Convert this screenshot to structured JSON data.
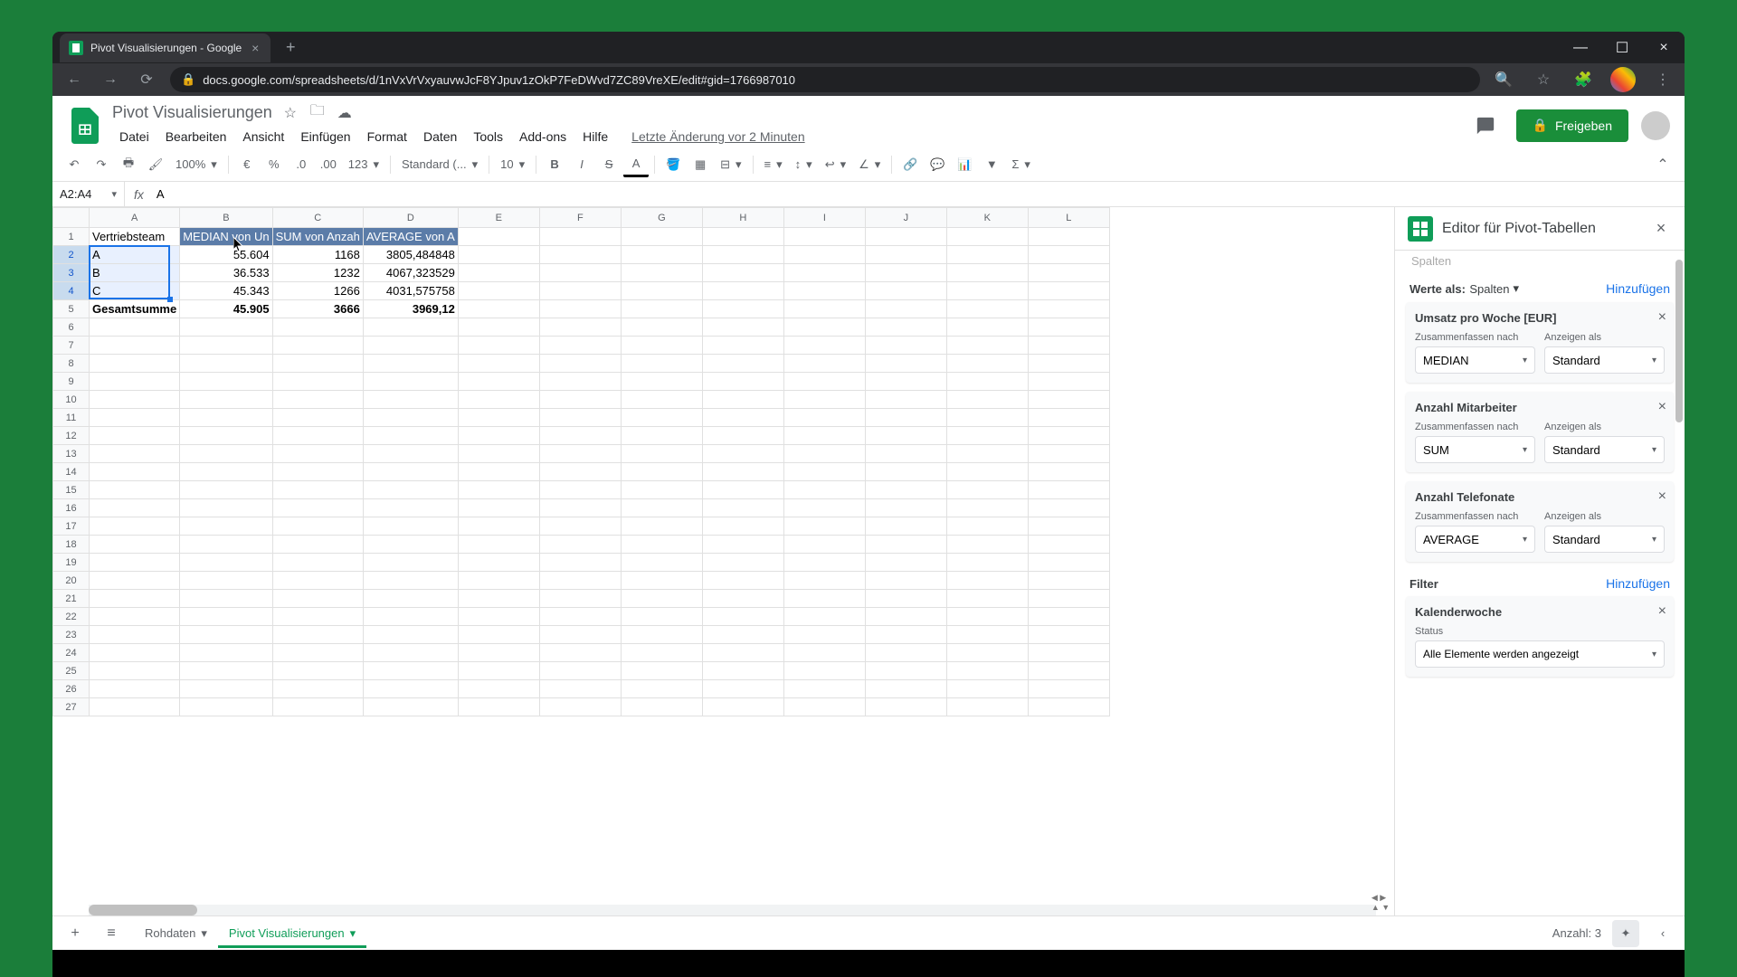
{
  "browser": {
    "tab_title": "Pivot Visualisierungen - Google",
    "url": "docs.google.com/spreadsheets/d/1nVxVrVxyauvwJcF8YJpuv1zOkP7FeDWvd7ZC89VreXE/edit#gid=1766987010"
  },
  "doc": {
    "title": "Pivot Visualisierungen",
    "menus": [
      "Datei",
      "Bearbeiten",
      "Ansicht",
      "Einfügen",
      "Format",
      "Daten",
      "Tools",
      "Add-ons",
      "Hilfe"
    ],
    "last_edit": "Letzte Änderung vor 2 Minuten",
    "share": "Freigeben"
  },
  "toolbar": {
    "zoom": "100%",
    "currency": "€",
    "percent": "%",
    "dec_less": ".0",
    "dec_more": ".00",
    "num_fmt": "123",
    "font": "Standard (...",
    "font_size": "10"
  },
  "formula": {
    "ref": "A2:A4",
    "value": "A"
  },
  "grid": {
    "columns": [
      "A",
      "B",
      "C",
      "D",
      "E",
      "F",
      "G",
      "H",
      "I",
      "J",
      "K",
      "L"
    ],
    "header_row": [
      "Vertriebsteam",
      "MEDIAN von Un",
      "SUM von Anzah",
      "AVERAGE von A"
    ],
    "data": [
      [
        "A",
        "55.604",
        "1168",
        "3805,484848"
      ],
      [
        "B",
        "36.533",
        "1232",
        "4067,323529"
      ],
      [
        "C",
        "45.343",
        "1266",
        "4031,575758"
      ]
    ],
    "total_row": [
      "Gesamtsumme",
      "45.905",
      "3666",
      "3969,12"
    ],
    "row_count": 27
  },
  "pivot": {
    "title": "Editor für Pivot-Tabellen",
    "columns_cutoff": "Spalten",
    "values": {
      "label": "Werte als:",
      "as_text": "Spalten",
      "add": "Hinzufügen",
      "cards": [
        {
          "title": "Umsatz pro Woche [EUR]",
          "summ_label": "Zusammenfassen nach",
          "summ": "MEDIAN",
          "show_label": "Anzeigen als",
          "show": "Standard"
        },
        {
          "title": "Anzahl Mitarbeiter",
          "summ_label": "Zusammenfassen nach",
          "summ": "SUM",
          "show_label": "Anzeigen als",
          "show": "Standard"
        },
        {
          "title": "Anzahl Telefonate",
          "summ_label": "Zusammenfassen nach",
          "summ": "AVERAGE",
          "show_label": "Anzeigen als",
          "show": "Standard"
        }
      ]
    },
    "filter": {
      "label": "Filter",
      "add": "Hinzufügen",
      "card": {
        "title": "Kalenderwoche",
        "status_label": "Status",
        "status": "Alle Elemente werden angezeigt"
      }
    }
  },
  "sheets_bar": {
    "tabs": [
      {
        "name": "Rohdaten",
        "active": false
      },
      {
        "name": "Pivot Visualisierungen",
        "active": true
      }
    ],
    "count": "Anzahl: 3"
  }
}
